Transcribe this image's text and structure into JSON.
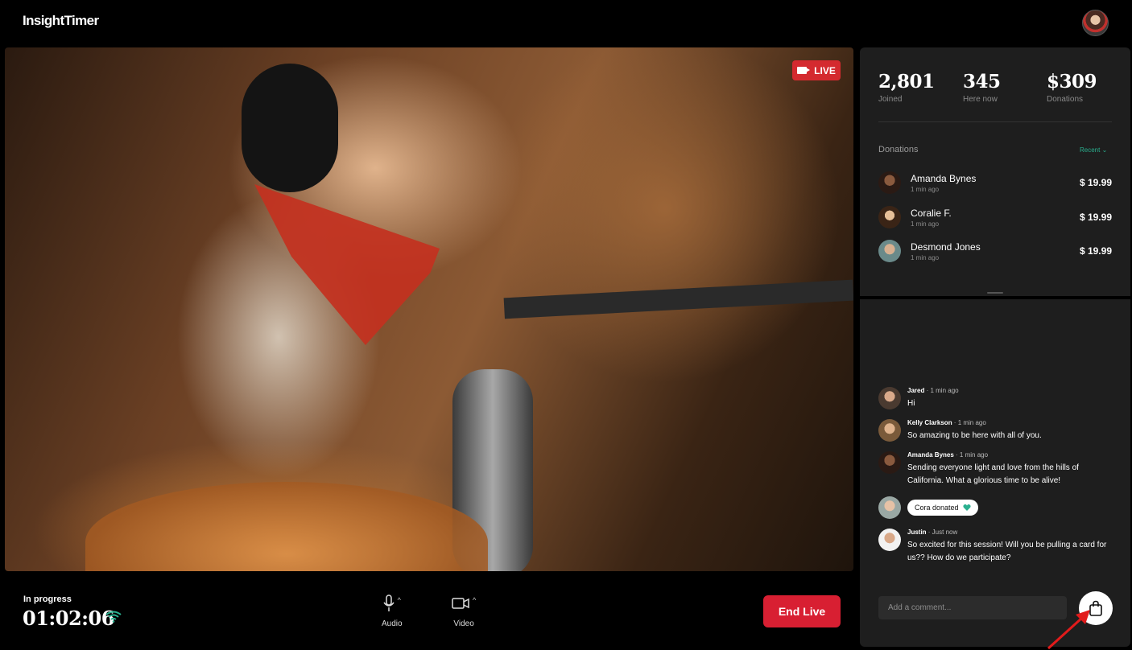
{
  "app": {
    "logo": "InsightTimer"
  },
  "stage": {
    "live_label": "LIVE"
  },
  "controls": {
    "status_label": "In progress",
    "timer": "01:02:06",
    "audio_label": "Audio",
    "video_label": "Video",
    "end_label": "End Live"
  },
  "stats": [
    {
      "value": "2,801",
      "label": "Joined"
    },
    {
      "value": "345",
      "label": "Here now"
    },
    {
      "value": "$309",
      "label": "Donations"
    }
  ],
  "donations": {
    "title": "Donations",
    "sort_label": "Recent",
    "items": [
      {
        "name": "Amanda Bynes",
        "time": "1 min ago",
        "amount": "$ 19.99"
      },
      {
        "name": "Coralie F.",
        "time": "1 min ago",
        "amount": "$ 19.99"
      },
      {
        "name": "Desmond Jones",
        "time": "1 min ago",
        "amount": "$ 19.99"
      }
    ]
  },
  "chat": {
    "messages": [
      {
        "author": "Jared",
        "time": "1 min ago",
        "text": "Hi"
      },
      {
        "author": "Kelly Clarkson",
        "time": "1 min ago",
        "text": "So amazing to be here with all of you."
      },
      {
        "author": "Amanda Bynes",
        "time": "1 min ago",
        "text": "Sending everyone light and love from the hills of California. What a glorious time to be alive!"
      },
      {
        "author": "Cora",
        "event": "Cora donated"
      },
      {
        "author": "Justin",
        "time": "Just now",
        "text": "So excited for this session! Will you be pulling a card for us?? How do we participate?"
      }
    ],
    "separator": " · ",
    "comment_placeholder": "Add a comment..."
  },
  "colors": {
    "live": "#d42a2f",
    "end_button": "#d81f32",
    "accent": "#2ab08f"
  },
  "icons": [
    "user-avatar",
    "video-camera-icon",
    "wifi-icon",
    "microphone-icon",
    "camera-icon",
    "chevron-up-icon",
    "chevron-down-icon",
    "heart-icon",
    "shopping-bag-icon",
    "arrow-pointer"
  ]
}
